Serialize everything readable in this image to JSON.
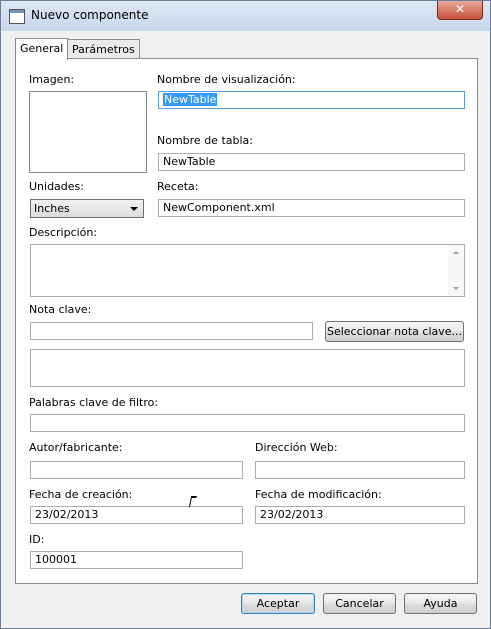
{
  "window": {
    "title": "Nuevo componente",
    "close_label": "✕"
  },
  "tabs": [
    {
      "label": "General"
    },
    {
      "label": "Parámetros"
    }
  ],
  "general": {
    "image_label": "Imagen:",
    "display_name_label": "Nombre de visualización:",
    "display_name_value": "NewTable",
    "table_name_label": "Nombre de tabla:",
    "table_name_value": "NewTable",
    "units_label": "Unidades:",
    "units_value": "Inches",
    "recipe_label": "Receta:",
    "recipe_value": "NewComponent.xml",
    "description_label": "Descripción:",
    "key_note_label": "Nota clave:",
    "select_key_note_button": "Seleccionar nota clave...",
    "filter_keywords_label": "Palabras clave de filtro:",
    "author_label": "Autor/fabricante:",
    "web_label": "Dirección Web:",
    "created_label": "Fecha de creación:",
    "created_value": "23/02/2013",
    "modified_label": "Fecha de modificación:",
    "modified_value": "23/02/2013",
    "id_label": "ID:",
    "id_value": "100001"
  },
  "footer": {
    "accept": "Aceptar",
    "cancel": "Cancelar",
    "help": "Ayuda"
  }
}
